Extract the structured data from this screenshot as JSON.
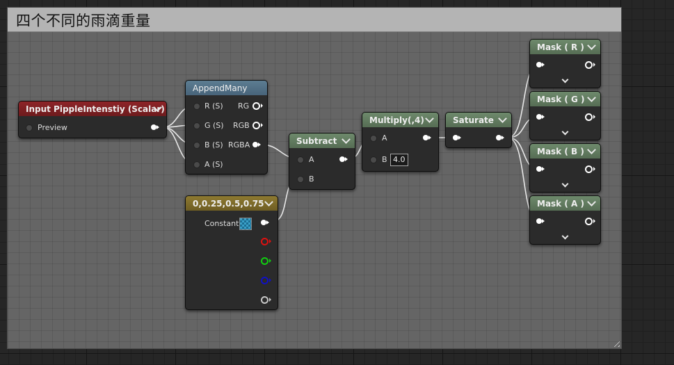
{
  "comment": {
    "title": "四个不同的雨滴重量"
  },
  "nodes": {
    "input": {
      "title": "Input PippleIntenstiy (Scalar)",
      "pin_label": "Preview"
    },
    "append": {
      "title": "AppendMany",
      "inputs": [
        "R (S)",
        "G (S)",
        "B (S)",
        "A (S)"
      ],
      "outputs": [
        "RG",
        "RGB",
        "RGBA"
      ]
    },
    "constant": {
      "title": "0,0.25,0.5,0.75",
      "pin_label": "Constant"
    },
    "subtract": {
      "title": "Subtract",
      "inputs": [
        "A",
        "B"
      ]
    },
    "multiply": {
      "title": "Multiply(,4)",
      "inputs": [
        "A",
        "B"
      ],
      "b_value": "4.0"
    },
    "saturate": {
      "title": "Saturate"
    },
    "masks": [
      {
        "title": "Mask ( R )"
      },
      {
        "title": "Mask ( G )"
      },
      {
        "title": "Mask ( B )"
      },
      {
        "title": "Mask ( A )"
      }
    ]
  },
  "colors": {
    "input_header": "#8e2428",
    "append_header": "#5d7d92",
    "math_header": "#6e8a6c",
    "constant_header": "#8e7a31",
    "comment_header": "#b4b4b4"
  }
}
